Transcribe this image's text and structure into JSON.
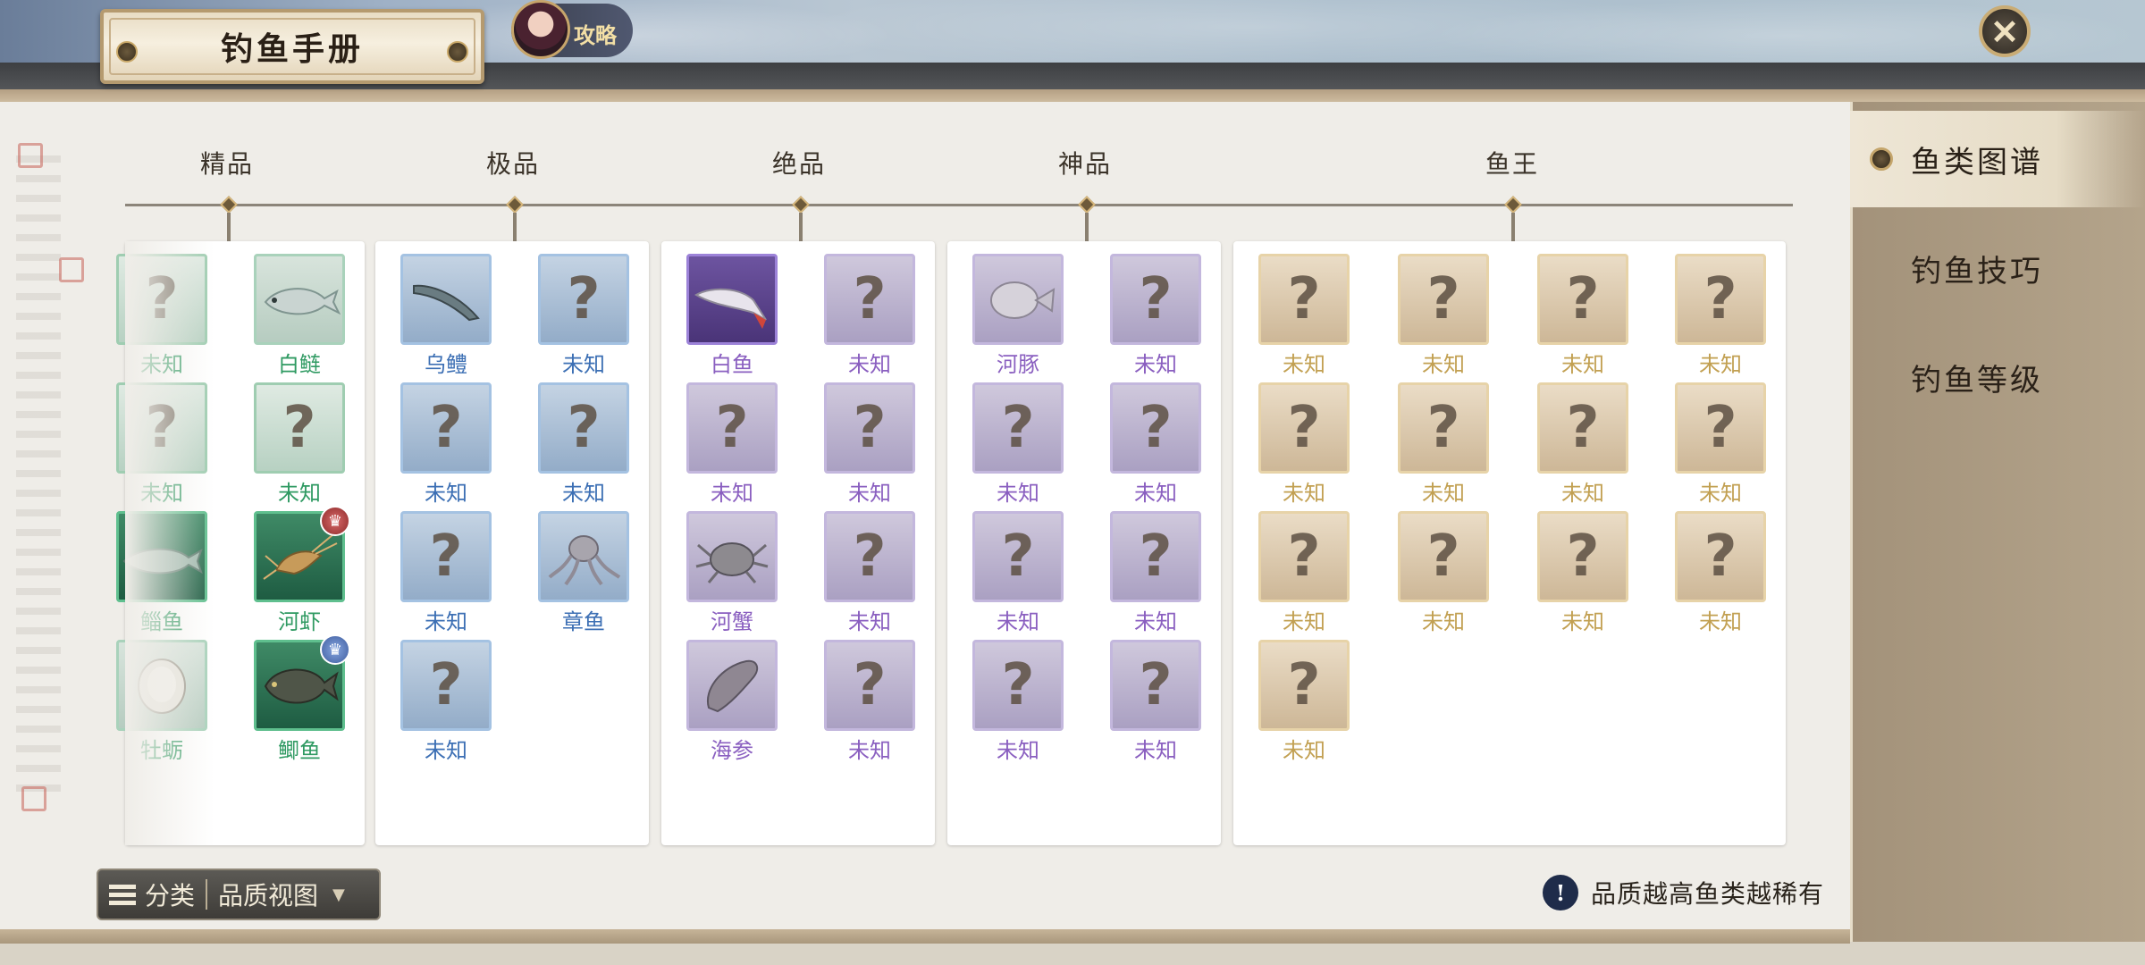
{
  "header": {
    "title": "钓鱼手册",
    "guide_label": "攻略",
    "close_symbol": "✕"
  },
  "tiers": [
    {
      "label": "精品"
    },
    {
      "label": "极品"
    },
    {
      "label": "绝品"
    },
    {
      "label": "神品"
    },
    {
      "label": "鱼王"
    }
  ],
  "cards": {
    "jingpin": [
      {
        "name": "未知",
        "state": "unknown"
      },
      {
        "name": "白鲢",
        "state": "known-dim",
        "icon": "silver-carp-icon"
      },
      {
        "name": "未知",
        "state": "unknown"
      },
      {
        "name": "未知",
        "state": "unknown"
      },
      {
        "name": "鲻鱼",
        "state": "known",
        "icon": "mullet-icon"
      },
      {
        "name": "河虾",
        "state": "known",
        "icon": "shrimp-icon",
        "badge": "trophy-red"
      },
      {
        "name": "牡蛎",
        "state": "known-dim",
        "icon": "oyster-icon"
      },
      {
        "name": "鲫鱼",
        "state": "known",
        "icon": "crucian-carp-icon",
        "badge": "trophy-blue"
      }
    ],
    "jipin": [
      {
        "name": "乌鳢",
        "state": "known",
        "icon": "snakehead-icon"
      },
      {
        "name": "未知",
        "state": "unknown"
      },
      {
        "name": "未知",
        "state": "unknown"
      },
      {
        "name": "未知",
        "state": "unknown"
      },
      {
        "name": "未知",
        "state": "unknown"
      },
      {
        "name": "章鱼",
        "state": "known",
        "icon": "octopus-icon"
      },
      {
        "name": "未知",
        "state": "unknown"
      }
    ],
    "juepin": [
      {
        "name": "白鱼",
        "state": "known",
        "icon": "whitefish-icon"
      },
      {
        "name": "未知",
        "state": "unknown"
      },
      {
        "name": "未知",
        "state": "unknown"
      },
      {
        "name": "未知",
        "state": "unknown"
      },
      {
        "name": "河蟹",
        "state": "known",
        "icon": "crab-icon"
      },
      {
        "name": "未知",
        "state": "unknown"
      },
      {
        "name": "海参",
        "state": "known",
        "icon": "sea-cucumber-icon"
      },
      {
        "name": "未知",
        "state": "unknown"
      }
    ],
    "shenpin": [
      {
        "name": "河豚",
        "state": "known",
        "icon": "pufferfish-icon"
      },
      {
        "name": "未知",
        "state": "unknown"
      },
      {
        "name": "未知",
        "state": "unknown"
      },
      {
        "name": "未知",
        "state": "unknown"
      },
      {
        "name": "未知",
        "state": "unknown"
      },
      {
        "name": "未知",
        "state": "unknown"
      },
      {
        "name": "未知",
        "state": "unknown"
      },
      {
        "name": "未知",
        "state": "unknown"
      }
    ],
    "yuwang": [
      {
        "name": "未知"
      },
      {
        "name": "未知"
      },
      {
        "name": "未知"
      },
      {
        "name": "未知"
      },
      {
        "name": "未知"
      },
      {
        "name": "未知"
      },
      {
        "name": "未知"
      },
      {
        "name": "未知"
      },
      {
        "name": "未知"
      },
      {
        "name": "未知"
      },
      {
        "name": "未知"
      },
      {
        "name": "未知"
      },
      {
        "name": "未知"
      }
    ]
  },
  "unknown_glyph": "?",
  "filter": {
    "category_label": "分类",
    "view_label": "品质视图",
    "caret": "▼"
  },
  "hint": {
    "icon": "!",
    "text": "品质越高鱼类越稀有"
  },
  "sidebar": {
    "items": [
      {
        "label": "鱼类图谱",
        "active": true
      },
      {
        "label": "钓鱼技巧"
      },
      {
        "label": "钓鱼等级"
      }
    ]
  },
  "colors": {
    "jingpin": "#2f9a62",
    "jipin": "#3c6fb4",
    "juepin": "#8a5fc0",
    "shenpin": "#8a5fc0",
    "yuwang": "#c2a052"
  }
}
